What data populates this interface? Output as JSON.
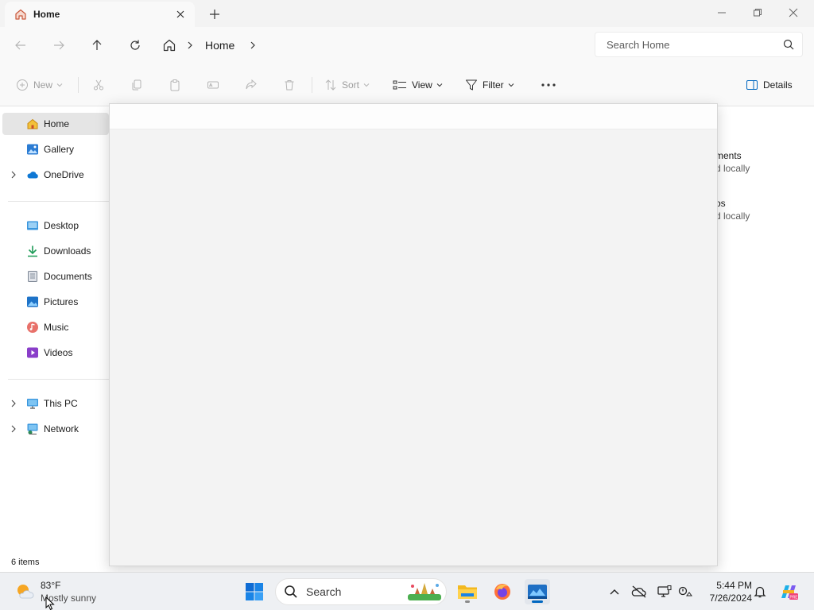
{
  "window": {
    "tab_title": "Home",
    "icons": {
      "tab": "home-icon",
      "close": "close-icon",
      "new_tab": "plus-icon",
      "minimize": "minimize-icon",
      "maximize": "restore-icon",
      "close_window": "close-icon"
    }
  },
  "address": {
    "breadcrumb": [
      "Home"
    ],
    "search_placeholder": "Search Home"
  },
  "commands": {
    "new": "New",
    "sort": "Sort",
    "view": "View",
    "filter": "Filter",
    "details": "Details"
  },
  "sidebar": {
    "items": [
      {
        "label": "Home",
        "icon": "home-icon",
        "selected": true
      },
      {
        "label": "Gallery",
        "icon": "gallery-icon"
      },
      {
        "label": "OneDrive",
        "icon": "cloud-icon",
        "expandable": true
      },
      {
        "label": "Desktop",
        "icon": "desktop-icon"
      },
      {
        "label": "Downloads",
        "icon": "download-icon"
      },
      {
        "label": "Documents",
        "icon": "documents-icon"
      },
      {
        "label": "Pictures",
        "icon": "pictures-icon"
      },
      {
        "label": "Music",
        "icon": "music-icon"
      },
      {
        "label": "Videos",
        "icon": "videos-icon"
      },
      {
        "label": "This PC",
        "icon": "pc-icon",
        "expandable": true
      },
      {
        "label": "Network",
        "icon": "network-icon",
        "expandable": true
      }
    ],
    "status": "6 items"
  },
  "content": {
    "partial_items": [
      {
        "name": "ments",
        "status": "d locally"
      },
      {
        "name": "os",
        "status": "d locally"
      }
    ]
  },
  "taskbar": {
    "weather_temp": "83°F",
    "weather_cond": "Mostly sunny",
    "search_label": "Search",
    "time": "5:44 PM",
    "date": "7/26/2024"
  },
  "colors": {
    "accent": "#0067c0",
    "folder": "#f3c13a",
    "selected": "#e5e5e5"
  }
}
